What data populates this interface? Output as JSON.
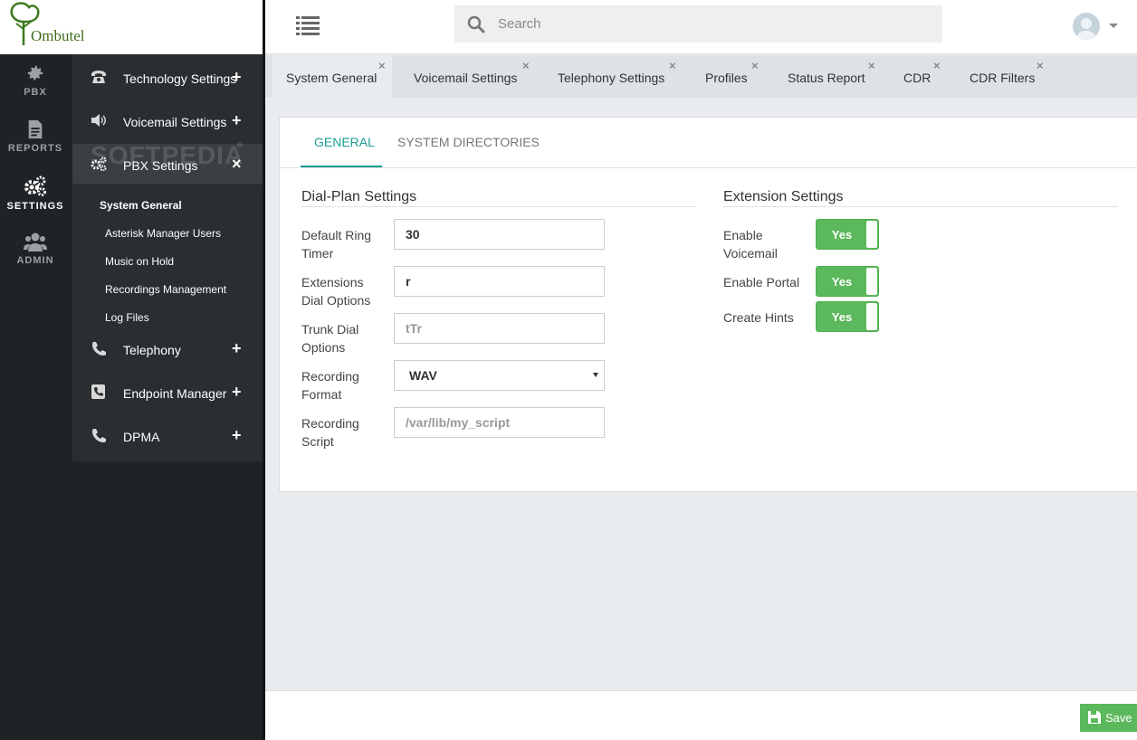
{
  "app": {
    "name": "Ombutel",
    "watermark": "SOFTPEDIA"
  },
  "rail": [
    {
      "label": "PBX",
      "icon": "gear-icon"
    },
    {
      "label": "REPORTS",
      "icon": "document-icon"
    },
    {
      "label": "SETTINGS",
      "icon": "gears-icon",
      "active": true
    },
    {
      "label": "ADMIN",
      "icon": "users-icon"
    }
  ],
  "subnav": {
    "groups": [
      {
        "label": "Technology Settings",
        "icon": "telephone-icon",
        "toggle": "+"
      },
      {
        "label": "Voicemail Settings",
        "icon": "speaker-icon",
        "toggle": "+"
      },
      {
        "label": "PBX Settings",
        "icon": "gears-icon",
        "toggle": "×"
      },
      {
        "label": "Telephony",
        "icon": "phone-icon",
        "toggle": "+"
      },
      {
        "label": "Endpoint Manager",
        "icon": "phone-square-icon",
        "toggle": "+"
      },
      {
        "label": "DPMA",
        "icon": "phone-icon",
        "toggle": "+"
      }
    ],
    "pbx_items": [
      "System General",
      "Asterisk Manager Users",
      "Music on Hold",
      "Recordings Management",
      "Log Files"
    ]
  },
  "search": {
    "placeholder": "Search"
  },
  "tabs": [
    "System General",
    "Voicemail Settings",
    "Telephony Settings",
    "Profiles",
    "Status Report",
    "CDR",
    "CDR Filters"
  ],
  "tab_close": "×",
  "panel_tabs": [
    "GENERAL",
    "SYSTEM DIRECTORIES"
  ],
  "dialplan": {
    "title": "Dial-Plan Settings",
    "fields": [
      {
        "label": "Default Ring Timer",
        "value": "30",
        "placeholder": ""
      },
      {
        "label": "Extensions Dial Options",
        "value": "r",
        "placeholder": ""
      },
      {
        "label": "Trunk Dial Options",
        "value": "",
        "placeholder": "tTr"
      },
      {
        "label": "Recording Format",
        "value": "WAV",
        "placeholder": ""
      },
      {
        "label": "Recording Script",
        "value": "",
        "placeholder": "/var/lib/my_script"
      }
    ]
  },
  "extension": {
    "title": "Extension Settings",
    "toggles": [
      {
        "label": "Enable Voicemail",
        "state": "Yes"
      },
      {
        "label": "Enable Portal",
        "state": "Yes"
      },
      {
        "label": "Create Hints",
        "state": "Yes"
      }
    ]
  },
  "footer": {
    "save_label": "Save"
  },
  "colors": {
    "accent": "#1a9d8f",
    "success": "#5cb85c",
    "sidebar": "#1f2326"
  }
}
